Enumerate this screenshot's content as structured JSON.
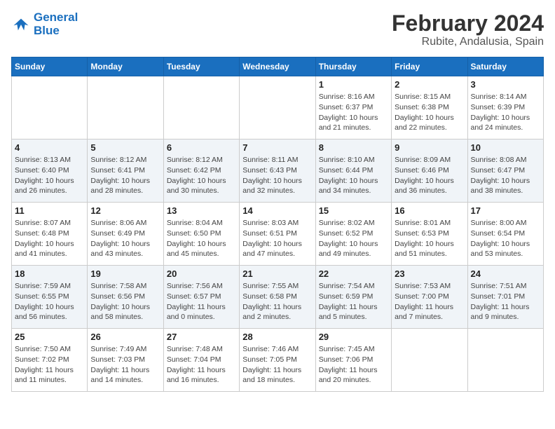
{
  "header": {
    "logo_line1": "General",
    "logo_line2": "Blue",
    "title": "February 2024",
    "subtitle": "Rubite, Andalusia, Spain"
  },
  "columns": [
    "Sunday",
    "Monday",
    "Tuesday",
    "Wednesday",
    "Thursday",
    "Friday",
    "Saturday"
  ],
  "weeks": [
    [
      {
        "day": "",
        "info": ""
      },
      {
        "day": "",
        "info": ""
      },
      {
        "day": "",
        "info": ""
      },
      {
        "day": "",
        "info": ""
      },
      {
        "day": "1",
        "info": "Sunrise: 8:16 AM\nSunset: 6:37 PM\nDaylight: 10 hours\nand 21 minutes."
      },
      {
        "day": "2",
        "info": "Sunrise: 8:15 AM\nSunset: 6:38 PM\nDaylight: 10 hours\nand 22 minutes."
      },
      {
        "day": "3",
        "info": "Sunrise: 8:14 AM\nSunset: 6:39 PM\nDaylight: 10 hours\nand 24 minutes."
      }
    ],
    [
      {
        "day": "4",
        "info": "Sunrise: 8:13 AM\nSunset: 6:40 PM\nDaylight: 10 hours\nand 26 minutes."
      },
      {
        "day": "5",
        "info": "Sunrise: 8:12 AM\nSunset: 6:41 PM\nDaylight: 10 hours\nand 28 minutes."
      },
      {
        "day": "6",
        "info": "Sunrise: 8:12 AM\nSunset: 6:42 PM\nDaylight: 10 hours\nand 30 minutes."
      },
      {
        "day": "7",
        "info": "Sunrise: 8:11 AM\nSunset: 6:43 PM\nDaylight: 10 hours\nand 32 minutes."
      },
      {
        "day": "8",
        "info": "Sunrise: 8:10 AM\nSunset: 6:44 PM\nDaylight: 10 hours\nand 34 minutes."
      },
      {
        "day": "9",
        "info": "Sunrise: 8:09 AM\nSunset: 6:46 PM\nDaylight: 10 hours\nand 36 minutes."
      },
      {
        "day": "10",
        "info": "Sunrise: 8:08 AM\nSunset: 6:47 PM\nDaylight: 10 hours\nand 38 minutes."
      }
    ],
    [
      {
        "day": "11",
        "info": "Sunrise: 8:07 AM\nSunset: 6:48 PM\nDaylight: 10 hours\nand 41 minutes."
      },
      {
        "day": "12",
        "info": "Sunrise: 8:06 AM\nSunset: 6:49 PM\nDaylight: 10 hours\nand 43 minutes."
      },
      {
        "day": "13",
        "info": "Sunrise: 8:04 AM\nSunset: 6:50 PM\nDaylight: 10 hours\nand 45 minutes."
      },
      {
        "day": "14",
        "info": "Sunrise: 8:03 AM\nSunset: 6:51 PM\nDaylight: 10 hours\nand 47 minutes."
      },
      {
        "day": "15",
        "info": "Sunrise: 8:02 AM\nSunset: 6:52 PM\nDaylight: 10 hours\nand 49 minutes."
      },
      {
        "day": "16",
        "info": "Sunrise: 8:01 AM\nSunset: 6:53 PM\nDaylight: 10 hours\nand 51 minutes."
      },
      {
        "day": "17",
        "info": "Sunrise: 8:00 AM\nSunset: 6:54 PM\nDaylight: 10 hours\nand 53 minutes."
      }
    ],
    [
      {
        "day": "18",
        "info": "Sunrise: 7:59 AM\nSunset: 6:55 PM\nDaylight: 10 hours\nand 56 minutes."
      },
      {
        "day": "19",
        "info": "Sunrise: 7:58 AM\nSunset: 6:56 PM\nDaylight: 10 hours\nand 58 minutes."
      },
      {
        "day": "20",
        "info": "Sunrise: 7:56 AM\nSunset: 6:57 PM\nDaylight: 11 hours\nand 0 minutes."
      },
      {
        "day": "21",
        "info": "Sunrise: 7:55 AM\nSunset: 6:58 PM\nDaylight: 11 hours\nand 2 minutes."
      },
      {
        "day": "22",
        "info": "Sunrise: 7:54 AM\nSunset: 6:59 PM\nDaylight: 11 hours\nand 5 minutes."
      },
      {
        "day": "23",
        "info": "Sunrise: 7:53 AM\nSunset: 7:00 PM\nDaylight: 11 hours\nand 7 minutes."
      },
      {
        "day": "24",
        "info": "Sunrise: 7:51 AM\nSunset: 7:01 PM\nDaylight: 11 hours\nand 9 minutes."
      }
    ],
    [
      {
        "day": "25",
        "info": "Sunrise: 7:50 AM\nSunset: 7:02 PM\nDaylight: 11 hours\nand 11 minutes."
      },
      {
        "day": "26",
        "info": "Sunrise: 7:49 AM\nSunset: 7:03 PM\nDaylight: 11 hours\nand 14 minutes."
      },
      {
        "day": "27",
        "info": "Sunrise: 7:48 AM\nSunset: 7:04 PM\nDaylight: 11 hours\nand 16 minutes."
      },
      {
        "day": "28",
        "info": "Sunrise: 7:46 AM\nSunset: 7:05 PM\nDaylight: 11 hours\nand 18 minutes."
      },
      {
        "day": "29",
        "info": "Sunrise: 7:45 AM\nSunset: 7:06 PM\nDaylight: 11 hours\nand 20 minutes."
      },
      {
        "day": "",
        "info": ""
      },
      {
        "day": "",
        "info": ""
      }
    ]
  ]
}
